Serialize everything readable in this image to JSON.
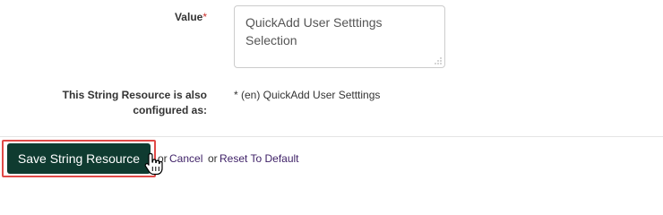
{
  "form": {
    "value_label": "Value",
    "required_marker": "*",
    "value_text": "QuickAdd User Setttings Selection",
    "configured_label": "This String Resource is also configured as:",
    "configured_value": "* (en) QuickAdd User Setttings"
  },
  "actions": {
    "save_label": "Save String Resource",
    "or_1": "or",
    "cancel_label": "Cancel",
    "or_2": "or",
    "reset_label": "Reset To Default"
  },
  "icons": {
    "cursor": "hand-pointer-icon",
    "resize": "resize-grip-icon"
  },
  "colors": {
    "save_button_bg": "#0f3b30",
    "highlight_outline": "#e04a48",
    "link": "#3d1f66",
    "required": "#c9302c"
  }
}
